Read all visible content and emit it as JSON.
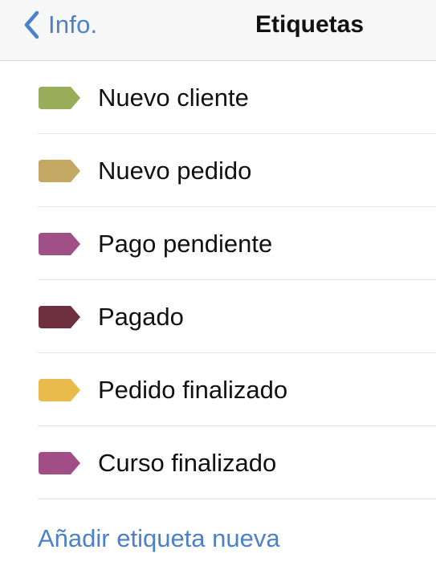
{
  "navbar": {
    "back_label": "Info.",
    "title": "Etiquetas"
  },
  "tags": [
    {
      "label": "Nuevo cliente",
      "color": "#98ad5a",
      "icon": "tag-icon"
    },
    {
      "label": "Nuevo pedido",
      "color": "#c2a862",
      "icon": "tag-icon"
    },
    {
      "label": "Pago pendiente",
      "color": "#a04f87",
      "icon": "tag-icon"
    },
    {
      "label": "Pagado",
      "color": "#6e2f3f",
      "icon": "tag-icon"
    },
    {
      "label": "Pedido finalizado",
      "color": "#e8bb4c",
      "icon": "tag-icon"
    },
    {
      "label": "Curso finalizado",
      "color": "#a14e86",
      "icon": "tag-icon"
    }
  ],
  "add_tag_label": "Añadir etiqueta nueva",
  "colors": {
    "accent": "#4a81c9",
    "navbar_background": "#f7f7f7",
    "separator": "#e2e2e6"
  }
}
